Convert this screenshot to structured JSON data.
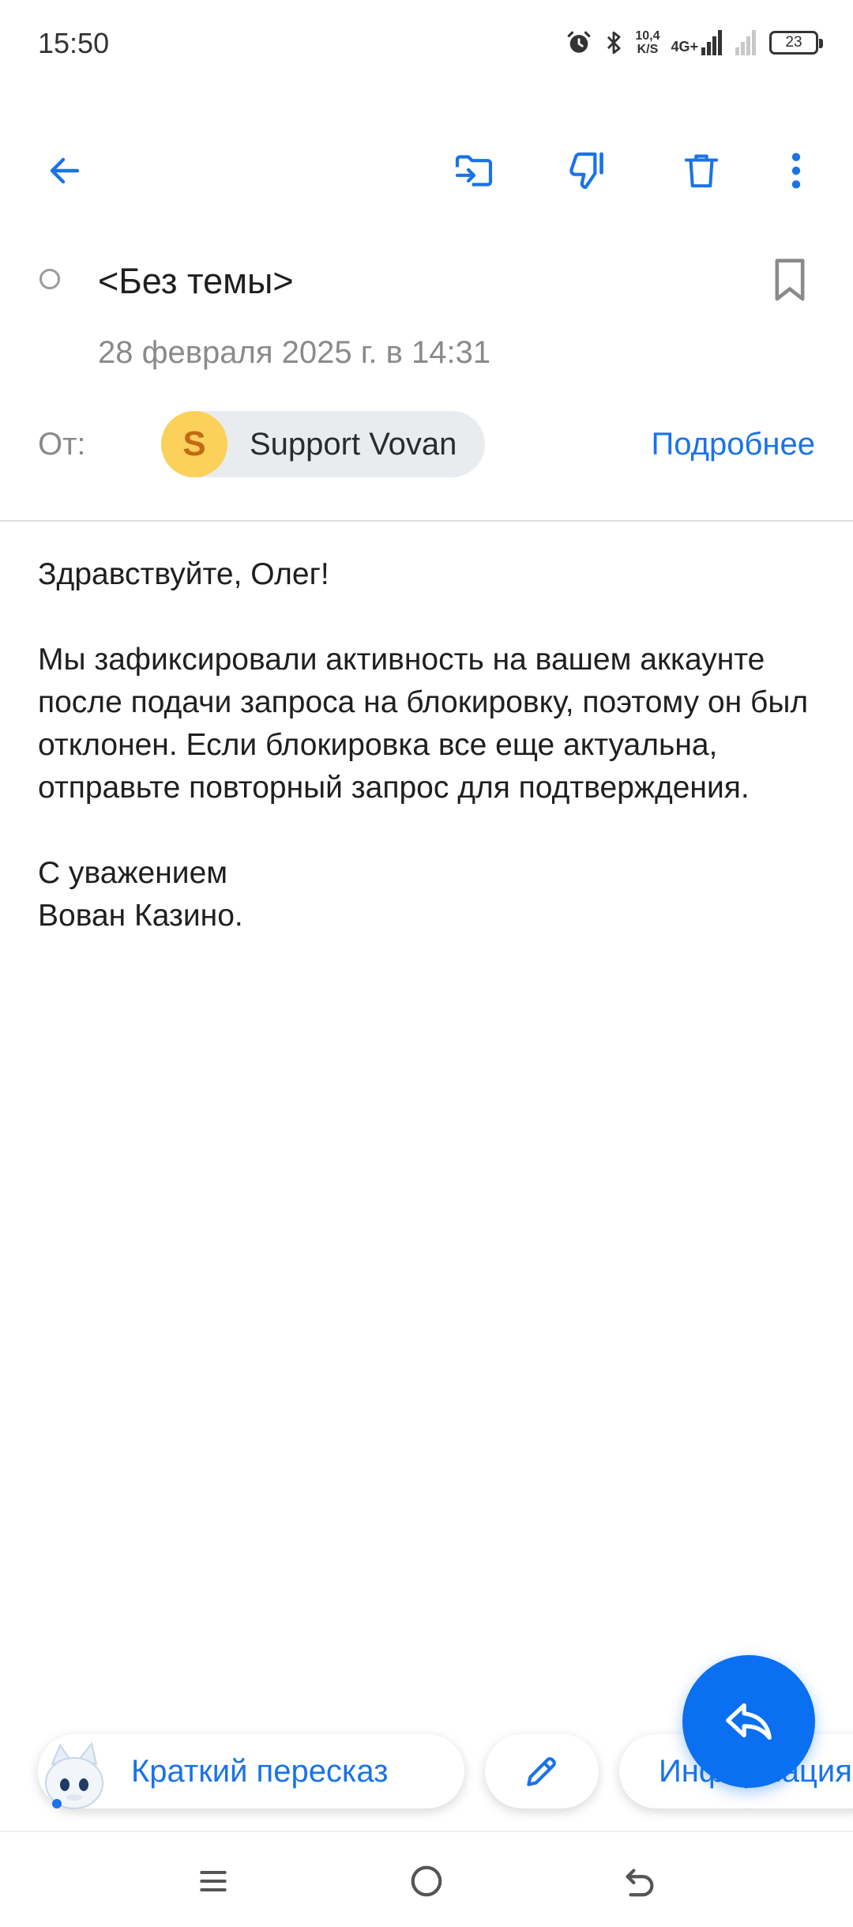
{
  "status_bar": {
    "time": "15:50",
    "net_speed_value": "10,4",
    "net_speed_unit": "K/S",
    "network_type": "4G+",
    "battery": "23"
  },
  "email": {
    "subject": "<Без темы>",
    "date": "28 февраля 2025 г. в 14:31",
    "from_label": "От:",
    "sender_initial": "S",
    "sender_name": "Support Vovan",
    "details_link": "Подробнее",
    "body": {
      "greeting": "Здравствуйте, Олег!",
      "main": "Мы зафиксировали активность на вашем аккаунте после подачи запроса на блокировку, поэтому он был отклонен. Если блокировка все еще актуальна, отправьте повторный запрос для подтверждения.",
      "closing": "С уважением",
      "signature": "Вован Казино."
    }
  },
  "actions": {
    "summary": "Краткий пересказ",
    "info": "Информация"
  },
  "colors": {
    "accent": "#1a73e8",
    "fab": "#0a6ff0",
    "avatar_bg": "#fbd15b"
  }
}
